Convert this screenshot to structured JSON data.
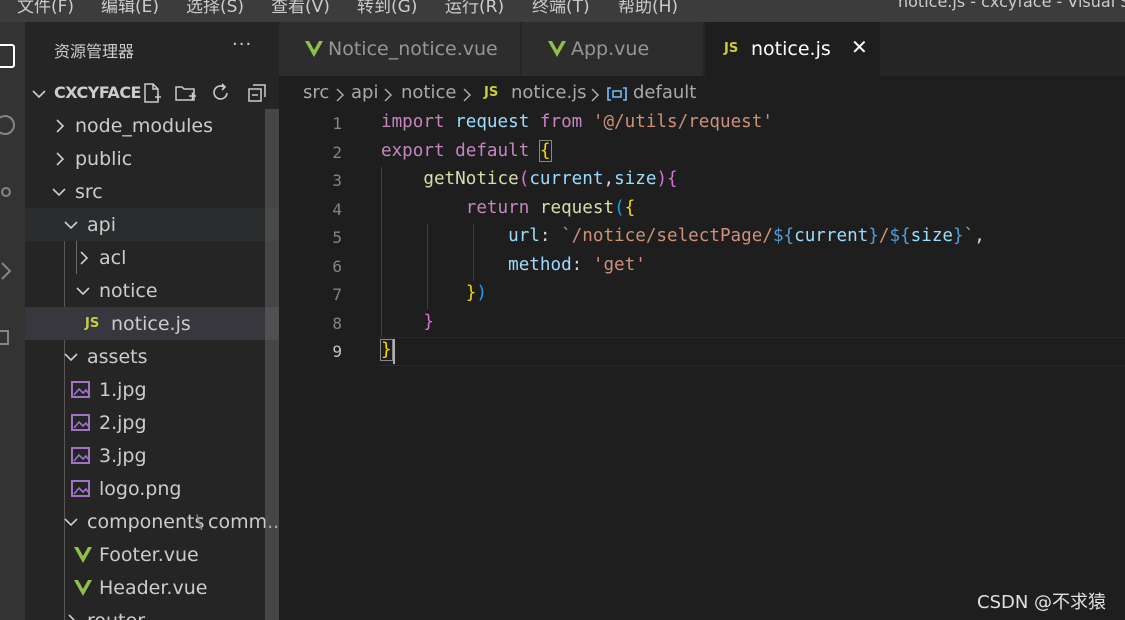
{
  "menu": {
    "items": [
      "文件(F)",
      "编辑(E)",
      "选择(S)",
      "查看(V)",
      "转到(G)",
      "运行(R)",
      "终端(T)",
      "帮助(H)"
    ],
    "window_title": "notice.js - cxcyface - Visual S"
  },
  "sidebar": {
    "title": "资源管理器",
    "more": "···",
    "project": "CXCYFACE",
    "tree": [
      {
        "label": "node_modules",
        "type": "folder",
        "state": "collapsed"
      },
      {
        "label": "public",
        "type": "folder",
        "state": "collapsed"
      },
      {
        "label": "src",
        "type": "folder",
        "state": "expanded"
      },
      {
        "label": "api",
        "type": "folder",
        "state": "expanded"
      },
      {
        "label": "acl",
        "type": "folder",
        "state": "collapsed"
      },
      {
        "label": "notice",
        "type": "folder",
        "state": "expanded"
      },
      {
        "label": "notice.js",
        "type": "js",
        "badge": "JS"
      },
      {
        "label": "assets",
        "type": "folder",
        "state": "expanded"
      },
      {
        "label": "1.jpg",
        "type": "image"
      },
      {
        "label": "2.jpg",
        "type": "image"
      },
      {
        "label": "3.jpg",
        "type": "image"
      },
      {
        "label": "logo.png",
        "type": "image"
      },
      {
        "label": "components",
        "suffix": "comm...",
        "type": "folder",
        "state": "expanded"
      },
      {
        "label": "Footer.vue",
        "type": "vue"
      },
      {
        "label": "Header.vue",
        "type": "vue"
      },
      {
        "label": "router",
        "type": "folder",
        "state": "collapsed"
      }
    ]
  },
  "tabs": [
    {
      "label": "Notice_notice.vue",
      "icon": "vue-icon",
      "active": false
    },
    {
      "label": "App.vue",
      "icon": "vue-icon",
      "active": false
    },
    {
      "label": "notice.js",
      "icon": "js-icon",
      "badge": "JS",
      "active": true,
      "close": "✕"
    }
  ],
  "breadcrumb": {
    "parts": [
      "src",
      "api",
      "notice",
      "notice.js",
      "default"
    ],
    "js_badge": "JS"
  },
  "code": {
    "line_numbers": [
      "1",
      "2",
      "3",
      "4",
      "5",
      "6",
      "7",
      "8",
      "9"
    ],
    "active_line": 9,
    "l1": {
      "t1": "import",
      "t2": " ",
      "t3": "request",
      "t4": " ",
      "t5": "from",
      "t6": " ",
      "t7": "'@/utils/request'"
    },
    "l2": {
      "t1": "export",
      "t2": " ",
      "t3": "default",
      "t4": " ",
      "t5": "{"
    },
    "l3": {
      "t0": "    ",
      "t1": "getNotice",
      "t2": "(",
      "t3": "current",
      "t4": ",",
      "t5": "size",
      "t6": ")",
      "t7": "{"
    },
    "l4": {
      "t0": "        ",
      "t1": "return",
      "t2": " ",
      "t3": "request",
      "t4": "(",
      "t5": "{"
    },
    "l5": {
      "t0": "            ",
      "t1": "url",
      "t2": ": ",
      "t3": "`/notice/selectPage/",
      "t4": "${",
      "t5": "current",
      "t6": "}",
      "t7": "/",
      "t8": "${",
      "t9": "size",
      "t10": "}",
      "t11": "`",
      "t12": ","
    },
    "l6": {
      "t0": "            ",
      "t1": "method",
      "t2": ": ",
      "t3": "'get'"
    },
    "l7": {
      "t0": "        ",
      "t1": "}",
      "t2": ")"
    },
    "l8": {
      "t0": "    ",
      "t1": "}"
    },
    "l9": {
      "t1": "}"
    }
  },
  "watermark": "CSDN @不求猿",
  "colors": {
    "js_badge": "#cbcb41",
    "vue": "#8dc149",
    "image": "#a074c4",
    "accent_bracket": "#ffd700"
  }
}
